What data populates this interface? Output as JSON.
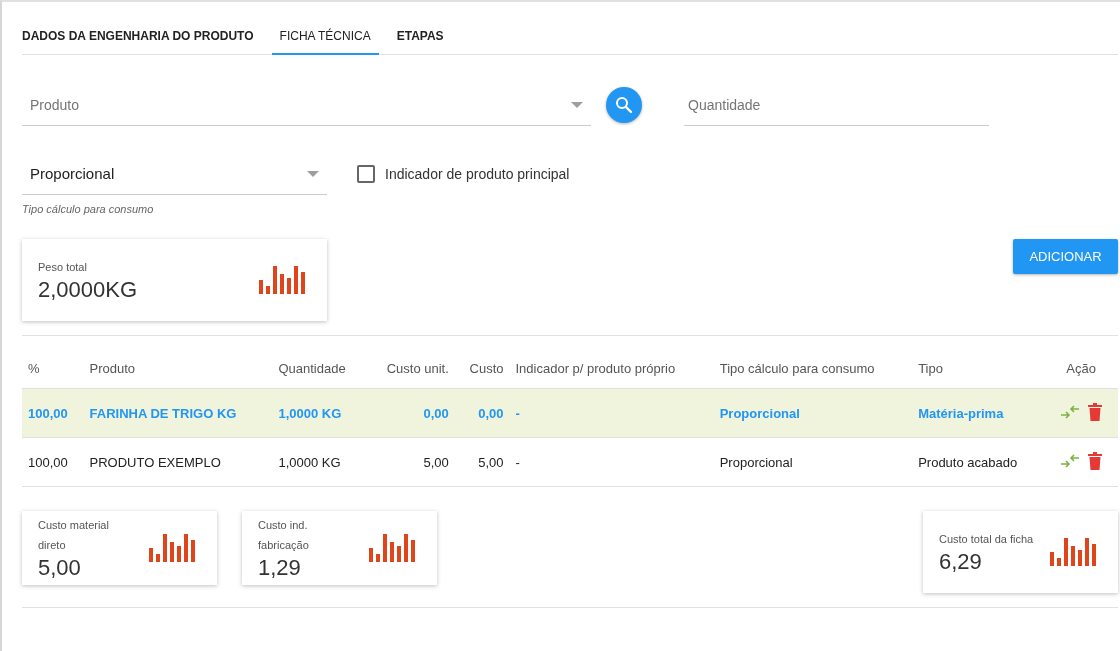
{
  "tabs": [
    {
      "label": "DADOS DA ENGENHARIA DO PRODUTO",
      "selected": false
    },
    {
      "label": "FICHA TÉCNICA",
      "selected": true
    },
    {
      "label": "ETAPAS",
      "selected": false
    }
  ],
  "produto_field": {
    "placeholder": "Produto"
  },
  "quantidade_field": {
    "placeholder": "Quantidade"
  },
  "tipo_calculo_select": {
    "value": "Proporcional",
    "helper": "Tipo cálculo para consumo"
  },
  "principal_checkbox": {
    "label": "Indicador de produto principal",
    "checked": false
  },
  "peso_card": {
    "label": "Peso total",
    "value": "2,0000KG"
  },
  "add_button": "ADICIONAR",
  "table": {
    "columns": [
      "%",
      "Produto",
      "Quantidade",
      "Custo unit.",
      "Custo",
      "Indicador p/ produto próprio",
      "Tipo cálculo para consumo",
      "Tipo",
      "Ação"
    ],
    "rows": [
      {
        "selected": true,
        "cells": [
          "100,00",
          "FARINHA DE TRIGO KG",
          "1,0000 KG",
          "0,00",
          "0,00",
          "-",
          "Proporcional",
          "Matéria-prima"
        ]
      },
      {
        "selected": false,
        "cells": [
          "100,00",
          "PRODUTO EXEMPLO",
          "1,0000 KG",
          "5,00",
          "5,00",
          "-",
          "Proporcional",
          "Produto acabado"
        ]
      }
    ]
  },
  "summary_cards": [
    {
      "label": "Custo material direto",
      "value": "5,00"
    },
    {
      "label": "Custo ind. fabricação",
      "value": "1,29"
    },
    {
      "label": "Custo total da ficha",
      "value": "6,29"
    }
  ]
}
